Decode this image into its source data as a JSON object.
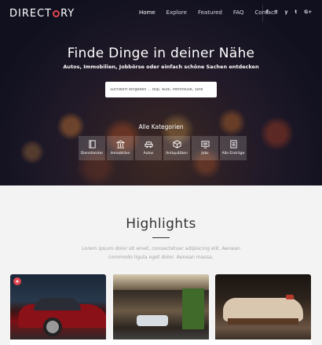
{
  "brand": {
    "logo_left": "DIRECT",
    "logo_right": "RY",
    "accent": "#e2454f"
  },
  "nav": {
    "items": [
      "Home",
      "Explore",
      "Featured",
      "FAQ",
      "Contact"
    ],
    "active": "Home"
  },
  "social": {
    "icons": [
      "f",
      "t",
      "y",
      "t",
      "G+"
    ],
    "names": [
      "facebook-icon",
      "twitter-icon",
      "yelp-icon",
      "tumblr-icon",
      "google-plus-icon"
    ]
  },
  "hero": {
    "title": "Finde Dinge in deiner Nähe",
    "subtitle": "Autos, Immobilien, Jobbörse oder einfach schöne Sachen entdecken"
  },
  "search": {
    "placeholder": "Suchwort eingeben ... Bsp. Audi, Penthouse, Sofa"
  },
  "categories": {
    "title": "Alle Kategorien",
    "items": [
      {
        "label": "Dienstleister",
        "icon": "book-icon"
      },
      {
        "label": "Immobilien",
        "icon": "building-icon"
      },
      {
        "label": "Autos",
        "icon": "car-icon"
      },
      {
        "label": "Antiquitäten",
        "icon": "box-icon"
      },
      {
        "label": "Jobs",
        "icon": "monitor-icon"
      },
      {
        "label": "Alle Einträge",
        "icon": "list-icon"
      }
    ]
  },
  "highlights": {
    "title": "Highlights",
    "text": "Lorem ipsum dolor sit amet, consectetuer adipiscing elit. Aenean commodo ligula eget dolor. Aenean massa.",
    "cards": [
      {
        "name": "card-car",
        "badge": "★"
      },
      {
        "name": "card-interior"
      },
      {
        "name": "card-sofa"
      }
    ]
  }
}
